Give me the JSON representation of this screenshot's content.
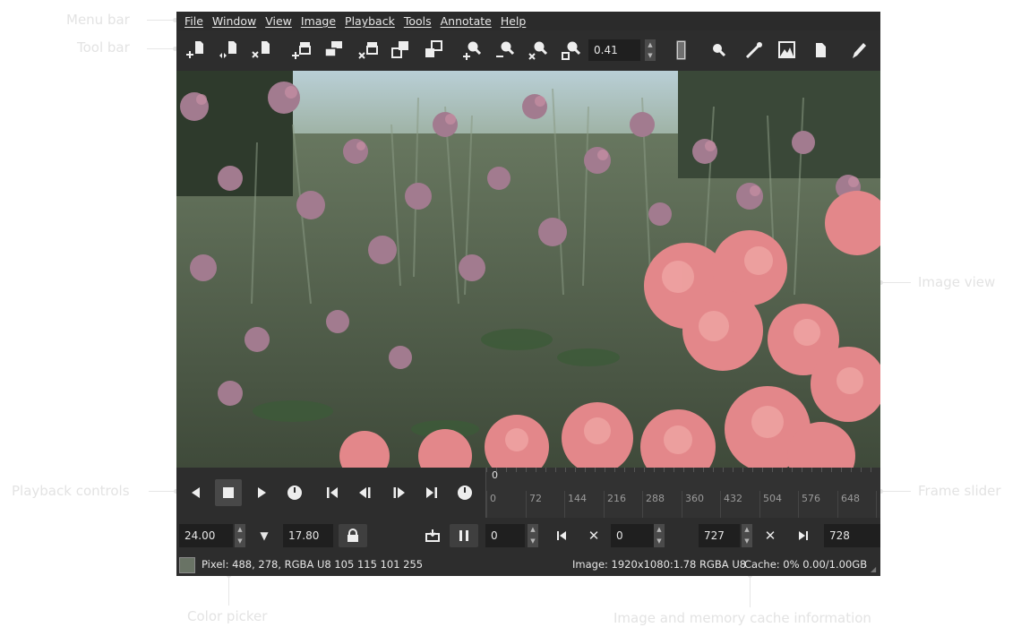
{
  "annotations": {
    "menu_bar": "Menu bar",
    "tool_bar": "Tool bar",
    "image_view": "Image view",
    "playback_controls": "Playback controls",
    "frame_slider": "Frame slider",
    "color_picker": "Color picker",
    "cache_info": "Image and memory cache information"
  },
  "menu": {
    "items": [
      "File",
      "Window",
      "View",
      "Image",
      "Playback",
      "Tools",
      "Annotate",
      "Help"
    ]
  },
  "toolbar": {
    "zoom_value": "0.41"
  },
  "timeline": {
    "current_frame": "0",
    "ticks": [
      "0",
      "72",
      "144",
      "216",
      "288",
      "360",
      "432",
      "504",
      "576",
      "648"
    ]
  },
  "controls": {
    "fps_target": "24.00",
    "fps_actual": "17.80",
    "frame_in": "0",
    "frame_current": "0",
    "frame_out_start": "727",
    "frame_out_end": "728"
  },
  "status": {
    "pixel_info": "Pixel: 488, 278, RGBA U8 105 115 101 255",
    "image_info": "Image: 1920x1080:1.78 RGBA U8",
    "cache_info": "Cache: 0% 0.00/1.00GB",
    "swatch_color": "#697365"
  },
  "icons": [
    "add-image-icon",
    "compare-image-icon",
    "remove-image-icon",
    "add-layer-icon",
    "stack-layers-icon",
    "remove-layer-icon",
    "layer-front-icon",
    "layer-back-icon",
    "zoom-in-icon",
    "zoom-out-icon",
    "zoom-reset-icon",
    "zoom-fit-icon",
    "color-bar-icon",
    "magnify-icon",
    "eyedropper-icon",
    "histogram-icon",
    "page-icon",
    "pencil-icon"
  ],
  "colors": {
    "window_bg": "#2d2d2d",
    "field_bg": "#1f1f1f",
    "text": "#e6e6e6",
    "callout_text": "#e3e3e3"
  }
}
